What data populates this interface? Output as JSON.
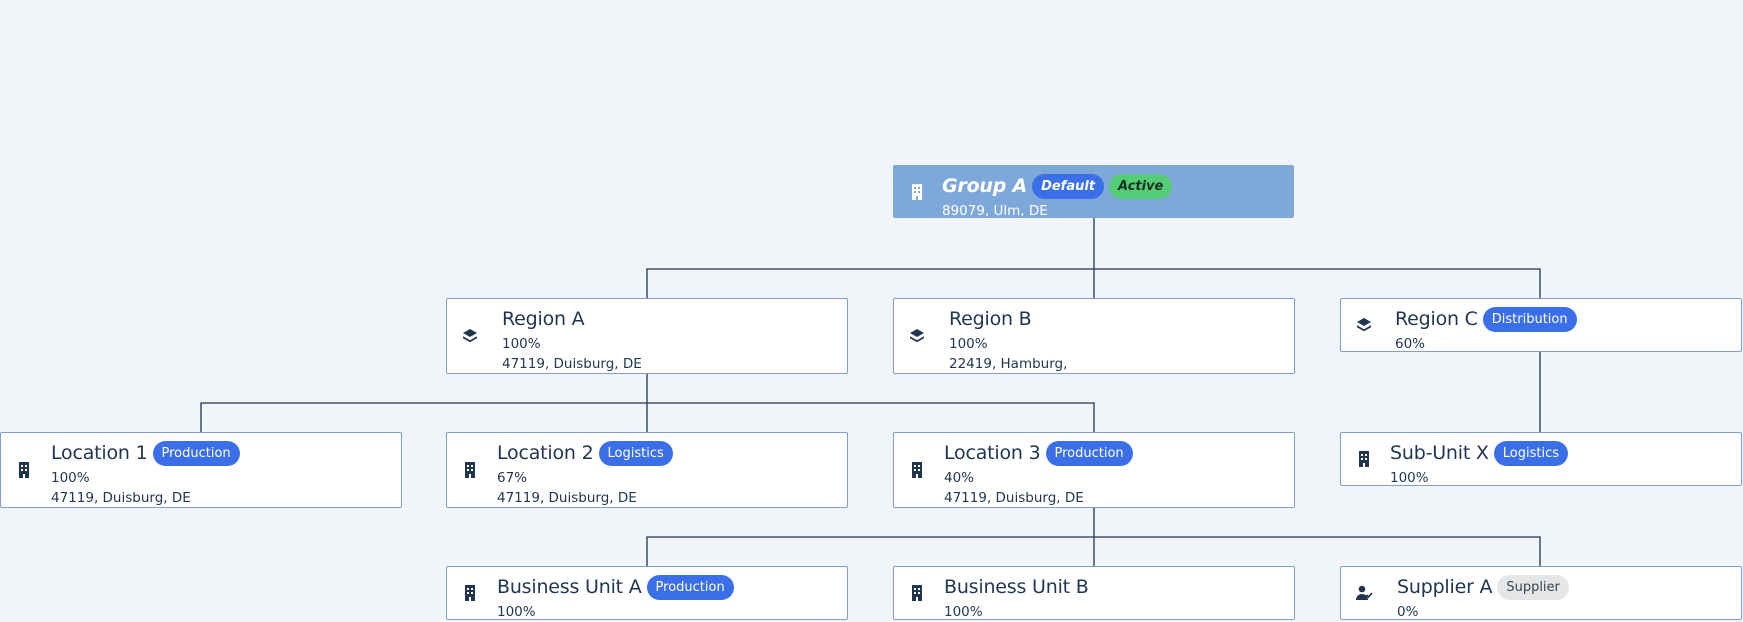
{
  "nodes": {
    "group_a": {
      "title": "Group A",
      "badges": [
        "Default",
        "Active"
      ],
      "address": "89079, Ulm, DE",
      "icon": "building-icon"
    },
    "region_a": {
      "title": "Region A",
      "percent": "100%",
      "address": "47119, Duisburg, DE",
      "icon": "layers-icon"
    },
    "region_b": {
      "title": "Region B",
      "percent": "100%",
      "address": "22419, Hamburg,",
      "icon": "layers-icon"
    },
    "region_c": {
      "title": "Region C",
      "badge": "Distribution",
      "percent": "60%",
      "icon": "layers-icon"
    },
    "location_1": {
      "title": "Location 1",
      "badge": "Production",
      "percent": "100%",
      "address": "47119, Duisburg, DE",
      "icon": "building-icon"
    },
    "location_2": {
      "title": "Location 2",
      "badge": "Logistics",
      "percent": "67%",
      "address": "47119, Duisburg, DE",
      "icon": "building-icon"
    },
    "location_3": {
      "title": "Location 3",
      "badge": "Production",
      "percent": "40%",
      "address": "47119, Duisburg, DE",
      "icon": "building-icon"
    },
    "sub_unit_x": {
      "title": "Sub-Unit X",
      "badge": "Logistics",
      "percent": "100%",
      "icon": "building-icon"
    },
    "business_unit_a": {
      "title": "Business Unit A",
      "badge": "Production",
      "percent": "100%",
      "icon": "building-icon"
    },
    "business_unit_b": {
      "title": "Business Unit B",
      "percent": "100%",
      "icon": "building-icon"
    },
    "supplier_a": {
      "title": "Supplier A",
      "badge": "Supplier",
      "percent": "0%",
      "icon": "user-check-icon"
    }
  },
  "colors": {
    "background": "#f1f5fa",
    "root_fill": "#7ea8d9",
    "node_border": "#7f9fd6",
    "badge_blue": "#3b6fe8",
    "badge_green": "#55cc77",
    "badge_gray": "#e5e6e8",
    "connector": "#1f3550"
  }
}
